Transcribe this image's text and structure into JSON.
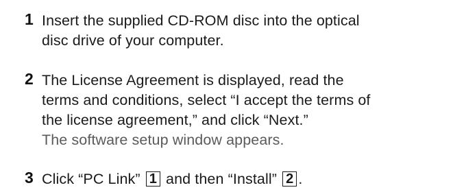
{
  "steps": [
    {
      "number": "1",
      "lines": [
        "Insert the supplied CD-ROM disc into the optical",
        "disc drive of your computer."
      ]
    },
    {
      "number": "2",
      "lines": [
        "The License Agreement is displayed, read the",
        "terms and conditions, select “I accept the terms of",
        "the license agreement,” and click “Next.”"
      ],
      "result": "The software setup window appears."
    },
    {
      "number": "3",
      "text_before": "Click “PC Link”",
      "callout_1": "1",
      "text_middle": "and then “Install”",
      "callout_2": "2",
      "text_after": "."
    }
  ]
}
